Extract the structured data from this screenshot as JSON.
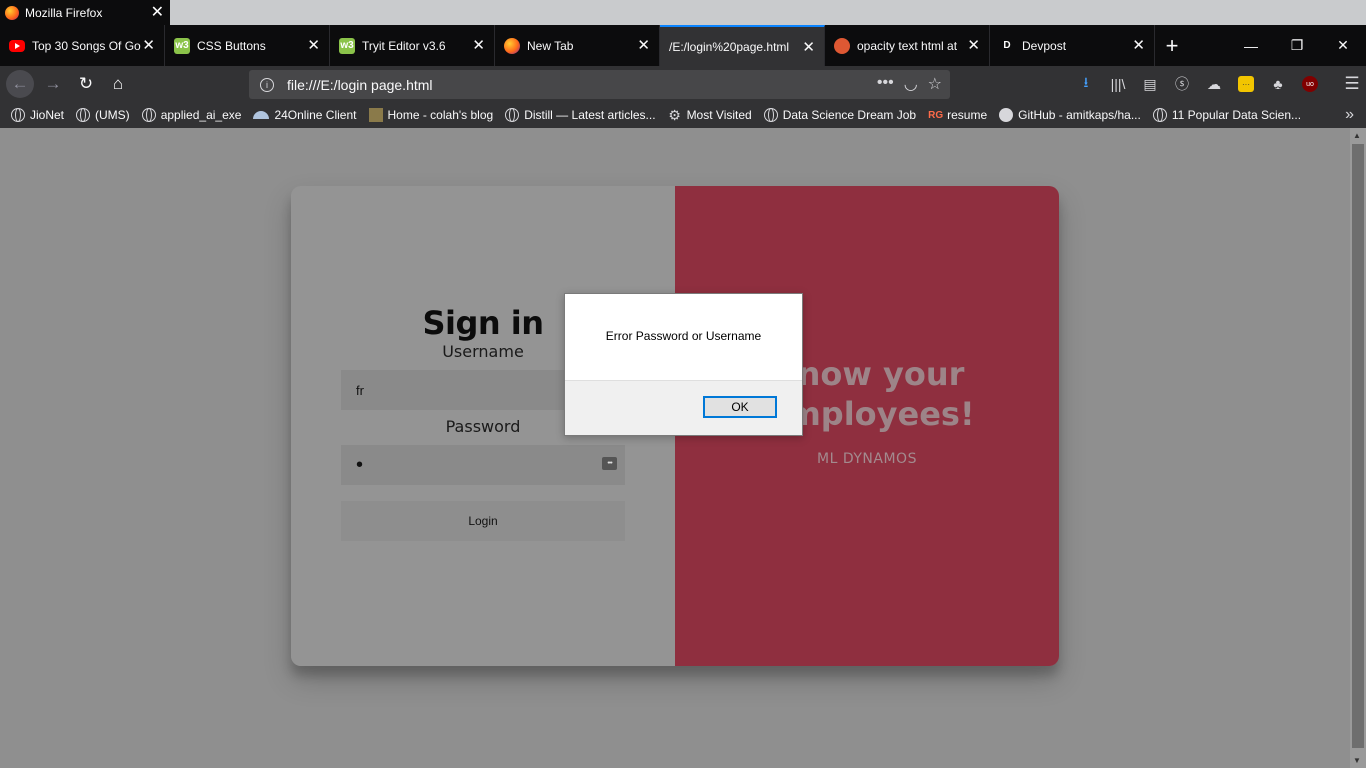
{
  "window": {
    "title": "Mozilla Firefox",
    "close_glyph": "✕"
  },
  "tabs": [
    {
      "label": "Top 30 Songs Of Go",
      "icon": "youtube-icon"
    },
    {
      "label": "CSS Buttons",
      "icon": "w3schools-icon",
      "fav": "w3"
    },
    {
      "label": "Tryit Editor v3.6",
      "icon": "w3schools-icon",
      "fav": "w3"
    },
    {
      "label": "New Tab",
      "icon": "firefox-icon"
    },
    {
      "label": "/E:/login%20page.html",
      "icon": "none",
      "active": true
    },
    {
      "label": "opacity text html at",
      "icon": "duckduckgo-icon"
    },
    {
      "label": "Devpost",
      "icon": "devpost-icon",
      "fav": "D"
    }
  ],
  "tab_close_glyph": "✕",
  "new_tab_glyph": "+",
  "window_controls": {
    "minimize": "—",
    "restore": "❐",
    "close": "✕"
  },
  "nav": {
    "back": "←",
    "forward": "→",
    "reload": "↻",
    "home": "⌂"
  },
  "url": {
    "value": "file:///E:/login page.html",
    "info_glyph": "i",
    "more": "•••",
    "pocket": "◡",
    "star": "☆"
  },
  "toolbar_icons": {
    "download": "⭳",
    "library": "|||\\",
    "sidebar": "▤",
    "ext1": "ⓢ",
    "ext2": "☁",
    "ext3": "···",
    "ext4": "♣",
    "ublock": "uo",
    "menu": "☰"
  },
  "bookmarks": [
    {
      "label": "JioNet",
      "icon": "globe-icon"
    },
    {
      "label": "(UMS)",
      "icon": "globe-icon"
    },
    {
      "label": "applied_ai_exe",
      "icon": "globe-icon"
    },
    {
      "label": "24Online Client",
      "icon": "cloud-icon"
    },
    {
      "label": "Home - colah's blog",
      "icon": "image-icon"
    },
    {
      "label": "Distill — Latest articles...",
      "icon": "globe-icon"
    },
    {
      "label": "Most Visited",
      "icon": "gear-icon"
    },
    {
      "label": "Data Science Dream Job",
      "icon": "globe-icon"
    },
    {
      "label": "resume",
      "icon": "researchgate-icon",
      "prefix": "RG"
    },
    {
      "label": "GitHub - amitkaps/ha...",
      "icon": "github-icon"
    },
    {
      "label": "11 Popular Data Scien...",
      "icon": "globe-icon"
    }
  ],
  "bookmarks_more": "»",
  "login": {
    "title": "Sign in",
    "username_label": "Username",
    "username_value": "fr",
    "password_label": "Password",
    "password_value": "•",
    "login_button": "Login",
    "key_glyph": "•••"
  },
  "overlay": {
    "headline_line1": "now your",
    "headline_line2": "mployees!",
    "subtitle": "ML DYNAMOS"
  },
  "dialog": {
    "message": "Error Password or Username",
    "ok_label": "OK"
  },
  "colors": {
    "tab_active_accent": "#0a84ff",
    "overlay_panel": "#8f2f3f",
    "dialog_button_border": "#0078d7"
  }
}
